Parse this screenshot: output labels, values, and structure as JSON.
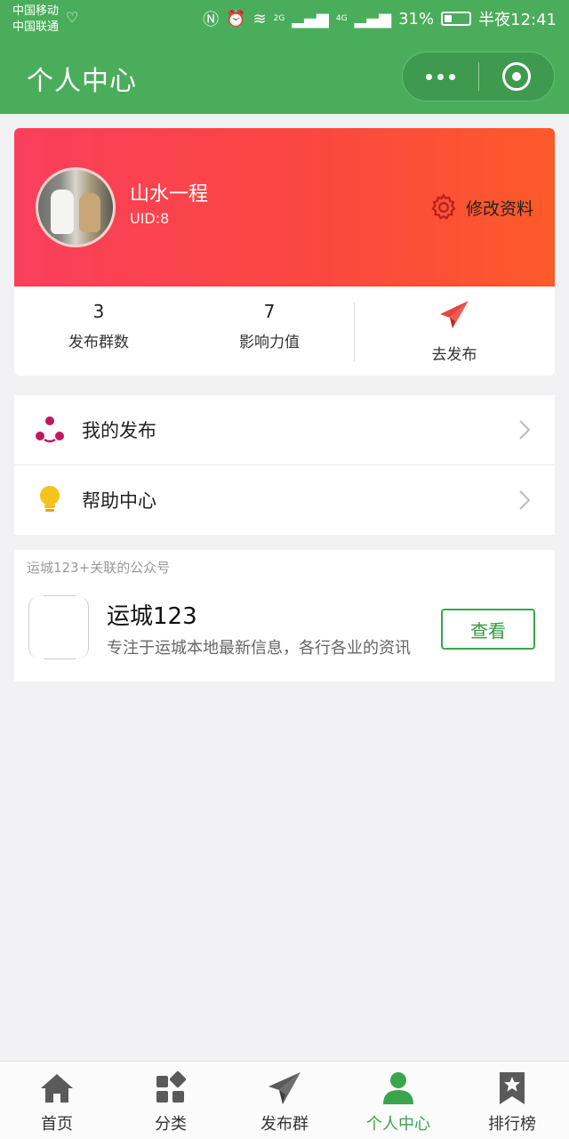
{
  "status_bar": {
    "carrier_1": "中国移动",
    "carrier_2": "中国联通",
    "network_2g": "2G",
    "network_4g": "4G",
    "battery": "31%",
    "time": "半夜12:41"
  },
  "nav": {
    "title": "个人中心"
  },
  "profile": {
    "name": "山水一程",
    "uid": "UID:8",
    "edit_label": "修改资料"
  },
  "stats": {
    "groups_count": "3",
    "groups_label": "发布群数",
    "influence_value": "7",
    "influence_label": "影响力值",
    "publish_label": "去发布"
  },
  "menu": [
    {
      "label": "我的发布",
      "icon": "share-nodes-icon"
    },
    {
      "label": "帮助中心",
      "icon": "lightbulb-icon"
    }
  ],
  "official_account": {
    "caption": "运城123+关联的公众号",
    "name": "运城123",
    "description": "专注于运城本地最新信息，各行各业的资讯",
    "button_label": "查看"
  },
  "tabs": [
    {
      "label": "首页",
      "icon": "home-icon",
      "active": false
    },
    {
      "label": "分类",
      "icon": "category-icon",
      "active": false
    },
    {
      "label": "发布群",
      "icon": "paper-plane-icon",
      "active": false
    },
    {
      "label": "个人中心",
      "icon": "user-icon",
      "active": true
    },
    {
      "label": "排行榜",
      "icon": "ranking-icon",
      "active": false
    }
  ],
  "colors": {
    "brand_green": "#4aad5b",
    "card_gradient_start": "#fa3f5c",
    "card_gradient_end": "#fd5a2a",
    "accent_red": "#e8433d"
  }
}
